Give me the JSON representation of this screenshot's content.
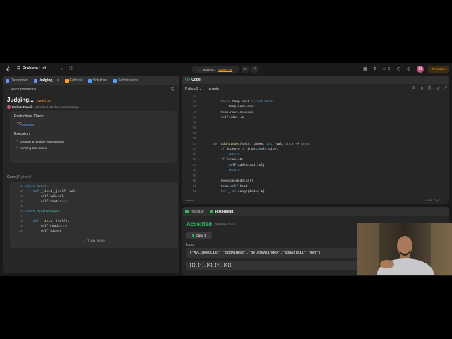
{
  "nav": {
    "problem_list": "Problem List",
    "judging": "Judging...",
    "speed_up": "Speed Up",
    "fire_count": "0",
    "premium": "Premium",
    "avatar_letter": "M"
  },
  "left_tabs": [
    "Description",
    "Judging...",
    "Editorial",
    "Solutions",
    "Submissions"
  ],
  "submission": {
    "back": "All Submissions",
    "status": "Judging...",
    "speed_up": "Speed Up",
    "author": "Mohan Pandit",
    "time": "submitted at a few seconds ago",
    "restrictions_title": "Restrictions Check",
    "webform": "webforms",
    "execution_title": "Execution",
    "steps": [
      "preparing runtime environment",
      "running test cases"
    ]
  },
  "code_label": "Code",
  "code_lang": "Python3",
  "snippet": {
    "lines": [
      {
        "n": "1",
        "t": "class Node:"
      },
      {
        "n": "2",
        "t": "    def __init__(self, val):"
      },
      {
        "n": "3",
        "t": "        self.val=val"
      },
      {
        "n": "4",
        "t": "        self.next=None"
      },
      {
        "n": "5",
        "t": ""
      },
      {
        "n": "6",
        "t": "class MyLinkedList:"
      },
      {
        "n": "7",
        "t": ""
      },
      {
        "n": "8",
        "t": "    def __init__(self):"
      },
      {
        "n": "9",
        "t": "        self.head=None"
      },
      {
        "n": "10",
        "t": "        self.size=0"
      }
    ],
    "view_more": "View more"
  },
  "editor": {
    "title": "Code",
    "lang": "Python3",
    "auto": "Auto",
    "saved": "Saved",
    "cursor": "Ln 86, Col 21",
    "lines": [
      {
        "n": "44",
        "t": ""
      },
      {
        "n": "45",
        "t": "        while temp.next is not None:"
      },
      {
        "n": "46",
        "t": "            temp=temp.next"
      },
      {
        "n": "47",
        "t": "        temp.next=newnode"
      },
      {
        "n": "48",
        "t": "        self.size+=1"
      },
      {
        "n": "49",
        "t": ""
      },
      {
        "n": "50",
        "t": ""
      },
      {
        "n": "51",
        "t": ""
      },
      {
        "n": "52",
        "t": ""
      },
      {
        "n": "53",
        "t": "    def addAtIndex(self, index: int, val: int) -> None:"
      },
      {
        "n": "54",
        "t": "        if index<0 or index>self.size:"
      },
      {
        "n": "55",
        "t": "            return"
      },
      {
        "n": "56",
        "t": "        if index==0:"
      },
      {
        "n": "57",
        "t": "            self.addAtHead(val)"
      },
      {
        "n": "58",
        "t": "            return"
      },
      {
        "n": "59",
        "t": ""
      },
      {
        "n": "60",
        "t": "        newnode=Node(val)"
      },
      {
        "n": "61",
        "t": "        temp=self.head"
      },
      {
        "n": "62",
        "t": "        for _ in range(index-1):"
      }
    ]
  },
  "test": {
    "tabs": [
      "Testcase",
      "Test Result"
    ],
    "accepted": "Accepted",
    "runtime": "Runtime: 0 ms",
    "case": "Case 1",
    "input_label": "Input",
    "input_ops": "[\"MyLinkedList\",\"addAtHead\",\"deleteAtIndex\",\"addAtTail\",\"get\"]",
    "input_args": "[[],[1],[0],[2],[0]]"
  },
  "colors": {
    "accent": "#ffa116",
    "success": "#2cbb5d",
    "panel": "#262626",
    "background": "#1a1a1a"
  }
}
